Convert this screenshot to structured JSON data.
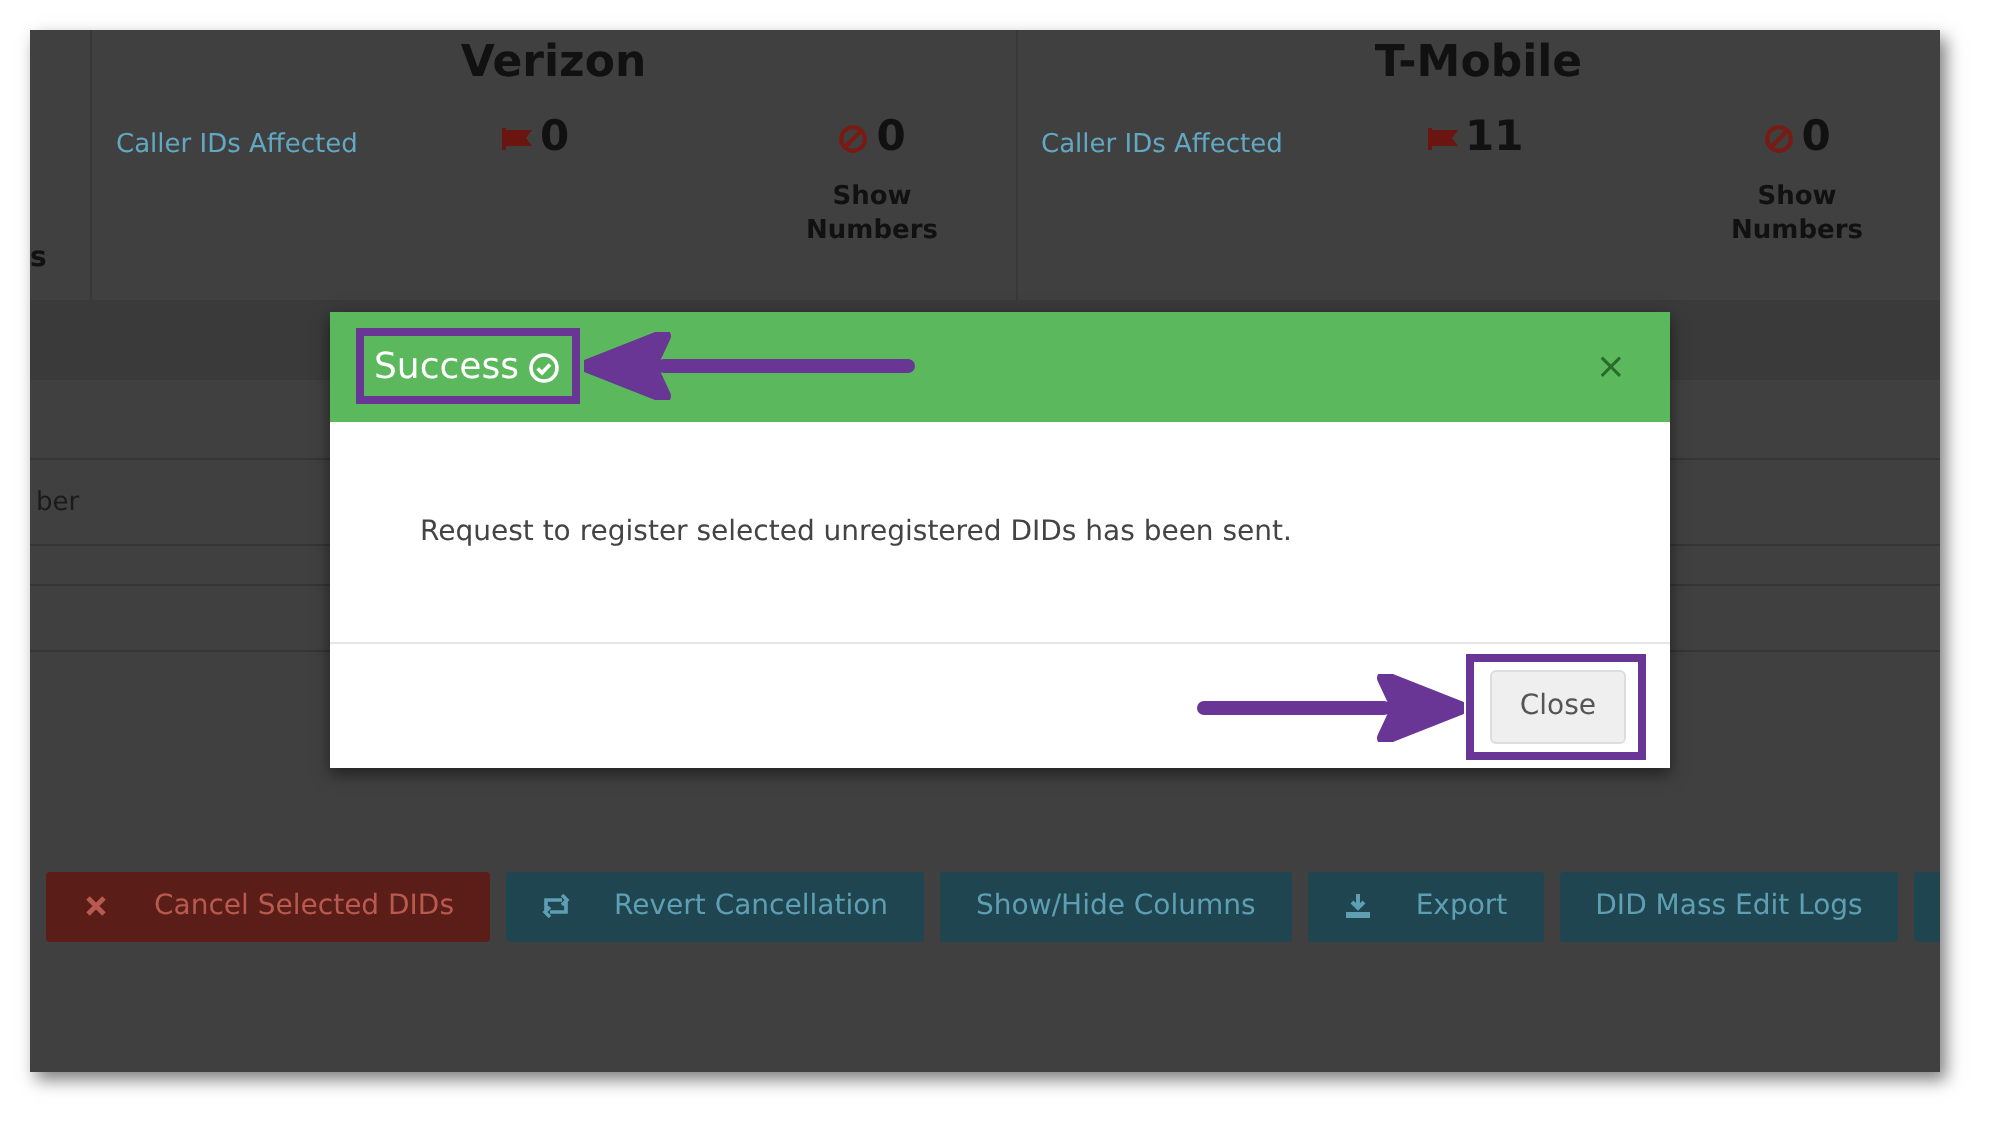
{
  "carriers": [
    {
      "name": "Verizon",
      "caller_ids_label": "Caller IDs Affected",
      "flagged_count": "0",
      "blocked_count": "0",
      "show_numbers_label": "Show Numbers"
    },
    {
      "name": "T-Mobile",
      "caller_ids_label": "Caller IDs Affected",
      "flagged_count": "11",
      "blocked_count": "0",
      "show_numbers_label": "Show Numbers"
    }
  ],
  "left_edge_text": "s",
  "table_rows": [
    {
      "text": "ber"
    }
  ],
  "buttons": [
    {
      "label": "Cancel Selected DIDs",
      "kind": "danger"
    },
    {
      "label": "Revert Cancellation",
      "kind": "info"
    },
    {
      "label": "Show/Hide Columns",
      "kind": "info"
    },
    {
      "label": "Export",
      "kind": "info"
    },
    {
      "label": "DID Mass Edit Logs",
      "kind": "info"
    },
    {
      "kind": "info"
    }
  ],
  "modal": {
    "title": "Success",
    "close_symbol": "×",
    "message": "Request to register selected unregistered DIDs has been sent.",
    "button": "Close"
  }
}
